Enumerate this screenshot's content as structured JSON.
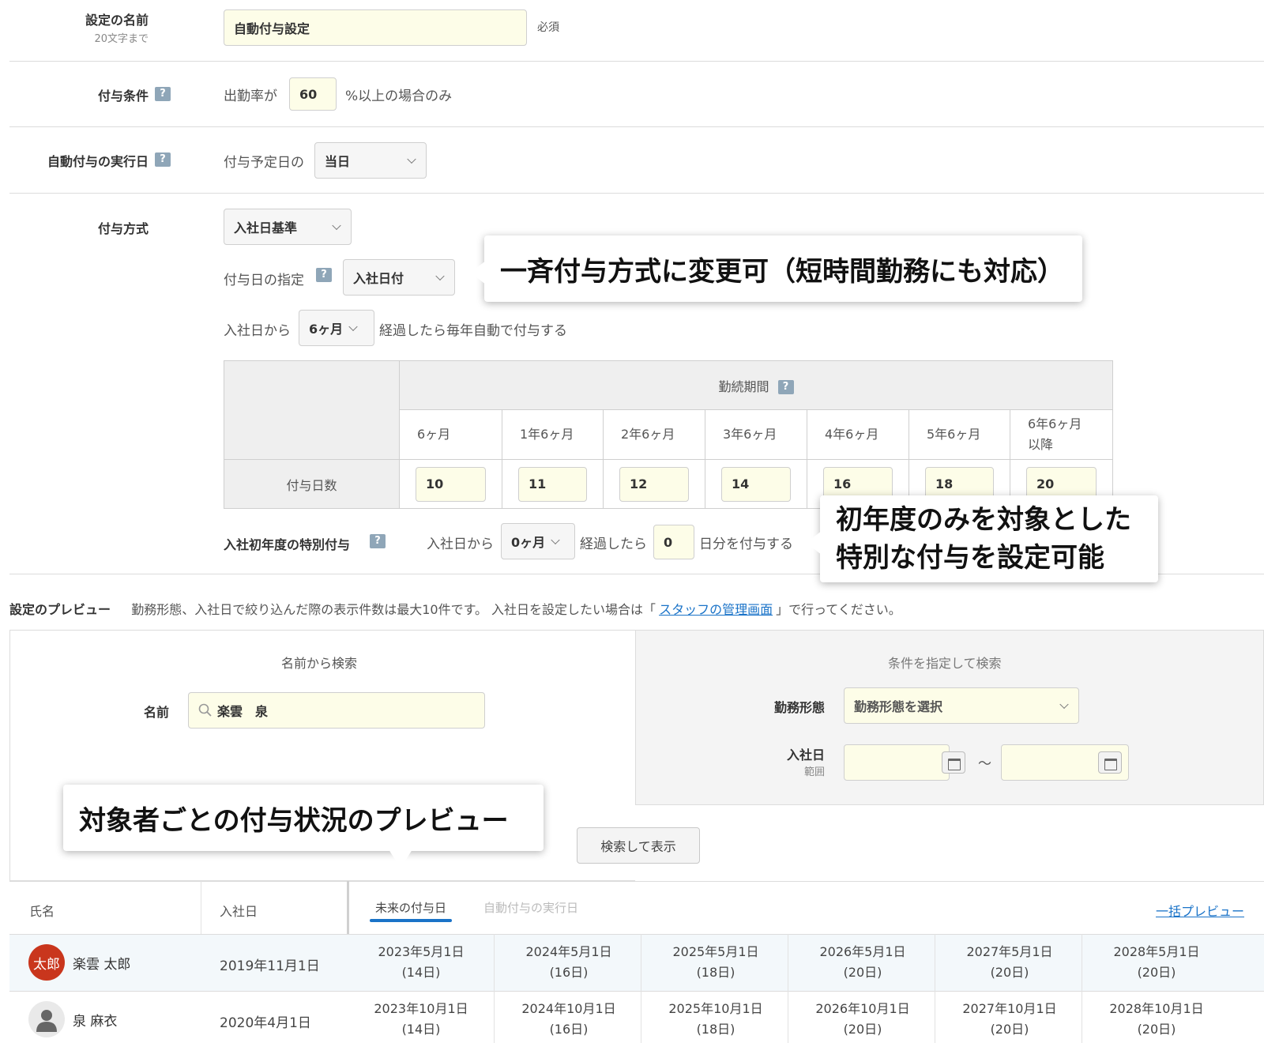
{
  "setting_name": {
    "label": "設定の名前",
    "hint": "20文字まで",
    "value": "自動付与設定",
    "required": "必須"
  },
  "condition": {
    "label": "付与条件",
    "prefix": "出勤率が",
    "value": "60",
    "suffix": "%以上の場合のみ"
  },
  "exec_day": {
    "label": "自動付与の実行日",
    "prefix": "付与予定日の",
    "value": "当日"
  },
  "method": {
    "label": "付与方式",
    "value": "入社日基準",
    "date_label": "付与日の指定",
    "date_value": "入社日付",
    "after_prefix": "入社日から",
    "after_value": "6ヶ月",
    "after_suffix": "経過したら毎年自動で付与する"
  },
  "grant_table": {
    "header": "勤続期間",
    "row_label": "付与日数",
    "periods": [
      "6ヶ月",
      "1年6ヶ月",
      "2年6ヶ月",
      "3年6ヶ月",
      "4年6ヶ月",
      "5年6ヶ月",
      "6年6ヶ月\n以降"
    ],
    "days": [
      "10",
      "11",
      "12",
      "14",
      "16",
      "18",
      "20"
    ]
  },
  "special": {
    "label": "入社初年度の特別付与",
    "prefix": "入社日から",
    "months": "0ヶ月",
    "mid": "経過したら",
    "days": "0",
    "suffix": "日分を付与する"
  },
  "callouts": {
    "c1": "一斉付与方式に変更可（短時間勤務にも対応）",
    "c2_line1": "初年度のみを対象とした",
    "c2_line2": "特別な付与を設定可能",
    "c3": "対象者ごとの付与状況のプレビュー"
  },
  "preview": {
    "title": "設定のプレビュー",
    "desc": "勤務形態、入社日で絞り込んだ際の表示件数は最大10件です。 入社日を設定したい場合は「",
    "link": "スタッフの管理画面",
    "desc_end": "」で行ってください。",
    "name_search_title": "名前から検索",
    "name_label": "名前",
    "name_value": "楽雲　泉",
    "cond_search_title": "条件を指定して検索",
    "work_type_label": "勤務形態",
    "work_type_placeholder": "勤務形態を選択",
    "join_label": "入社日",
    "join_sub": "範囲",
    "tilde": "～",
    "search_button": "検索して表示"
  },
  "results": {
    "col_name": "氏名",
    "col_join": "入社日",
    "tab_future": "未来の付与日",
    "tab_exec": "自動付与の実行日",
    "bulk_preview": "一括プレビュー",
    "rows": [
      {
        "avatar": "太郎",
        "name": "楽雲 太郎",
        "join": "2019年11月1日",
        "dates": [
          [
            "2023年5月1日",
            "(14日)"
          ],
          [
            "2024年5月1日",
            "(16日)"
          ],
          [
            "2025年5月1日",
            "(18日)"
          ],
          [
            "2026年5月1日",
            "(20日)"
          ],
          [
            "2027年5月1日",
            "(20日)"
          ],
          [
            "2028年5月1日",
            "(20日)"
          ]
        ]
      },
      {
        "avatar": "",
        "name": "泉 麻衣",
        "join": "2020年4月1日",
        "dates": [
          [
            "2023年10月1日",
            "(14日)"
          ],
          [
            "2024年10月1日",
            "(16日)"
          ],
          [
            "2025年10月1日",
            "(18日)"
          ],
          [
            "2026年10月1日",
            "(20日)"
          ],
          [
            "2027年10月1日",
            "(20日)"
          ],
          [
            "2028年10月1日",
            "(20日)"
          ]
        ]
      }
    ]
  },
  "colors": {
    "input_bg": "#fdfde8",
    "link": "#1a73c8",
    "avatar": "#c9361d",
    "tab_underline": "#1a73c8"
  }
}
